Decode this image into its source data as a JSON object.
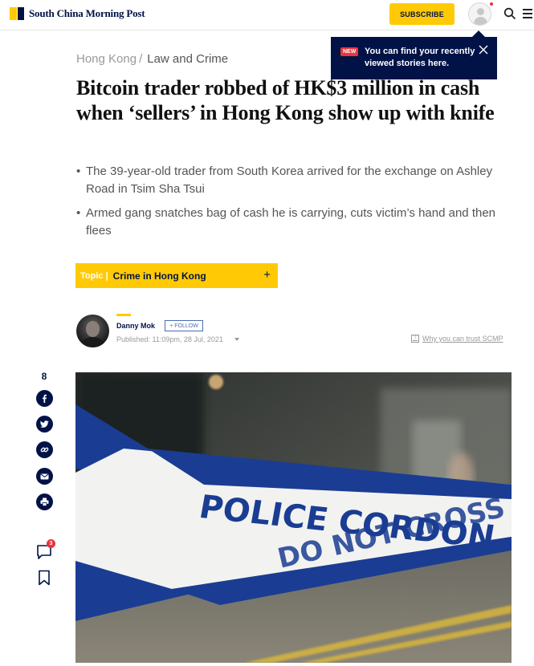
{
  "header": {
    "logo_text": "South China Morning Post",
    "subscribe_label": "SUBSCRIBE",
    "icons": [
      "user-icon",
      "search-icon",
      "menu-icon"
    ]
  },
  "tooltip": {
    "badge": "NEW",
    "message": "You can find your recently viewed stories here."
  },
  "breadcrumb": {
    "region": "Hong Kong",
    "separator": "/",
    "section": "Law and Crime"
  },
  "article": {
    "headline": "Bitcoin trader robbed of HK$3 million in cash when ‘sellers’ in Hong Kong show up with knife",
    "bullets": [
      "The 39-year-old trader from South Korea arrived for the exchange on Ashley Road in Tsim Sha Tsui",
      "Armed gang snatches bag of cash he is carrying, cuts victim’s hand and then flees"
    ]
  },
  "topic": {
    "label": "Topic |",
    "name": "Crime in Hong Kong",
    "plus": "+"
  },
  "author": {
    "name": "Danny Mok",
    "follow_label": "+ FOLLOW",
    "published": "Published: 11:09pm, 28 Jul, 2021",
    "trust_label": "Why you can trust SCMP"
  },
  "share": {
    "count": "8",
    "buttons": [
      "facebook-icon",
      "twitter-icon",
      "link-icon",
      "email-icon",
      "print-icon"
    ],
    "comment_count": "3"
  },
  "hero_image": {
    "tape_line1": "POLICE CORDON",
    "tape_line2": "DO NOT CROSS"
  },
  "colors": {
    "brand_yellow": "#ffca05",
    "brand_navy": "#001246",
    "alert_red": "#e8353b"
  }
}
